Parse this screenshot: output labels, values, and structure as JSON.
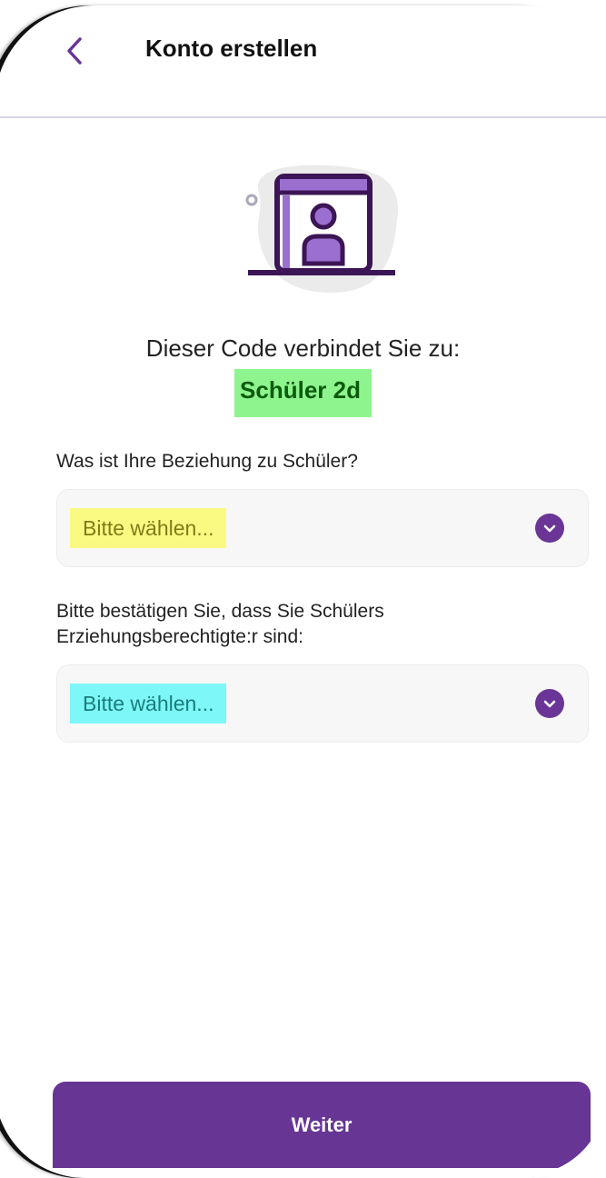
{
  "header": {
    "title": "Konto erstellen",
    "back_icon": "chevron-left-icon"
  },
  "illustration": {
    "icon": "user-profile-window-icon",
    "accent_color": "#6a3596"
  },
  "connection": {
    "text": "Dieser Code verbindet Sie zu:",
    "student_name": "Schüler 2d"
  },
  "relationship": {
    "label": "Was ist Ihre Beziehung zu Schüler?",
    "placeholder": "Bitte wählen...",
    "icon": "chevron-down-icon"
  },
  "guardian_confirm": {
    "label_line1": "Bitte bestätigen Sie, dass Sie Schülers",
    "label_line2": "Erziehungsberechtigte:r sind:",
    "placeholder": "Bitte wählen...",
    "icon": "chevron-down-icon"
  },
  "footer": {
    "next_label": "Weiter"
  },
  "colors": {
    "primary": "#673593",
    "highlight_green": "#8ef58e",
    "highlight_yellow": "#fafa83",
    "highlight_cyan": "#7df7f7"
  }
}
